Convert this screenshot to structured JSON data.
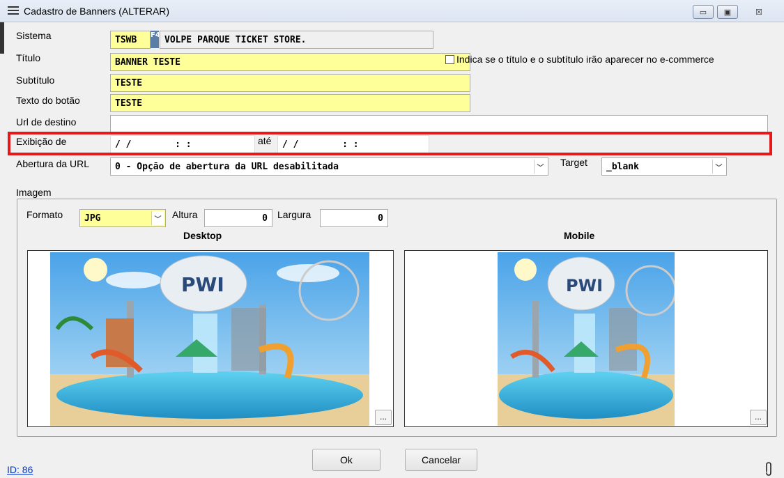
{
  "window": {
    "title": "Cadastro de Banners (ALTERAR)",
    "controls": {
      "minimize": "▭",
      "maximize": "▣",
      "close": "☒"
    }
  },
  "form": {
    "sistema": {
      "label": "Sistema",
      "code": "TSWB",
      "f4": "F4",
      "name": "VOLPE PARQUE TICKET STORE."
    },
    "titulo": {
      "label": "Título",
      "value": "BANNER TESTE",
      "checkbox_label": "Indica se o título e o subtítulo irão aparecer no e-commerce",
      "checked": false
    },
    "subtitulo": {
      "label": "Subtítulo",
      "value": "TESTE"
    },
    "texto_botao": {
      "label": "Texto do botão",
      "value": "TESTE"
    },
    "url_destino": {
      "label": "Url de destino",
      "value": ""
    },
    "exibicao": {
      "label": "Exibição de",
      "from": "/ /        : :",
      "ate_label": "até",
      "to": "/ /        : :"
    },
    "abertura": {
      "label": "Abertura da URL",
      "value": "0 - Opção de abertura da URL desabilitada"
    },
    "target": {
      "label": "Target",
      "value": "_blank"
    }
  },
  "imagem": {
    "group_label": "Imagem",
    "formato_label": "Formato",
    "formato": "JPG",
    "altura_label": "Altura",
    "altura": "0",
    "largura_label": "Largura",
    "largura": "0",
    "desktop_label": "Desktop",
    "mobile_label": "Mobile",
    "banner_text": "PWI",
    "browse": "..."
  },
  "buttons": {
    "ok": "Ok",
    "cancelar": "Cancelar"
  },
  "footer": {
    "id": "ID: 86"
  },
  "colors": {
    "required_field": "#ffff99",
    "highlight": "#e3191b",
    "link": "#0033cc"
  }
}
